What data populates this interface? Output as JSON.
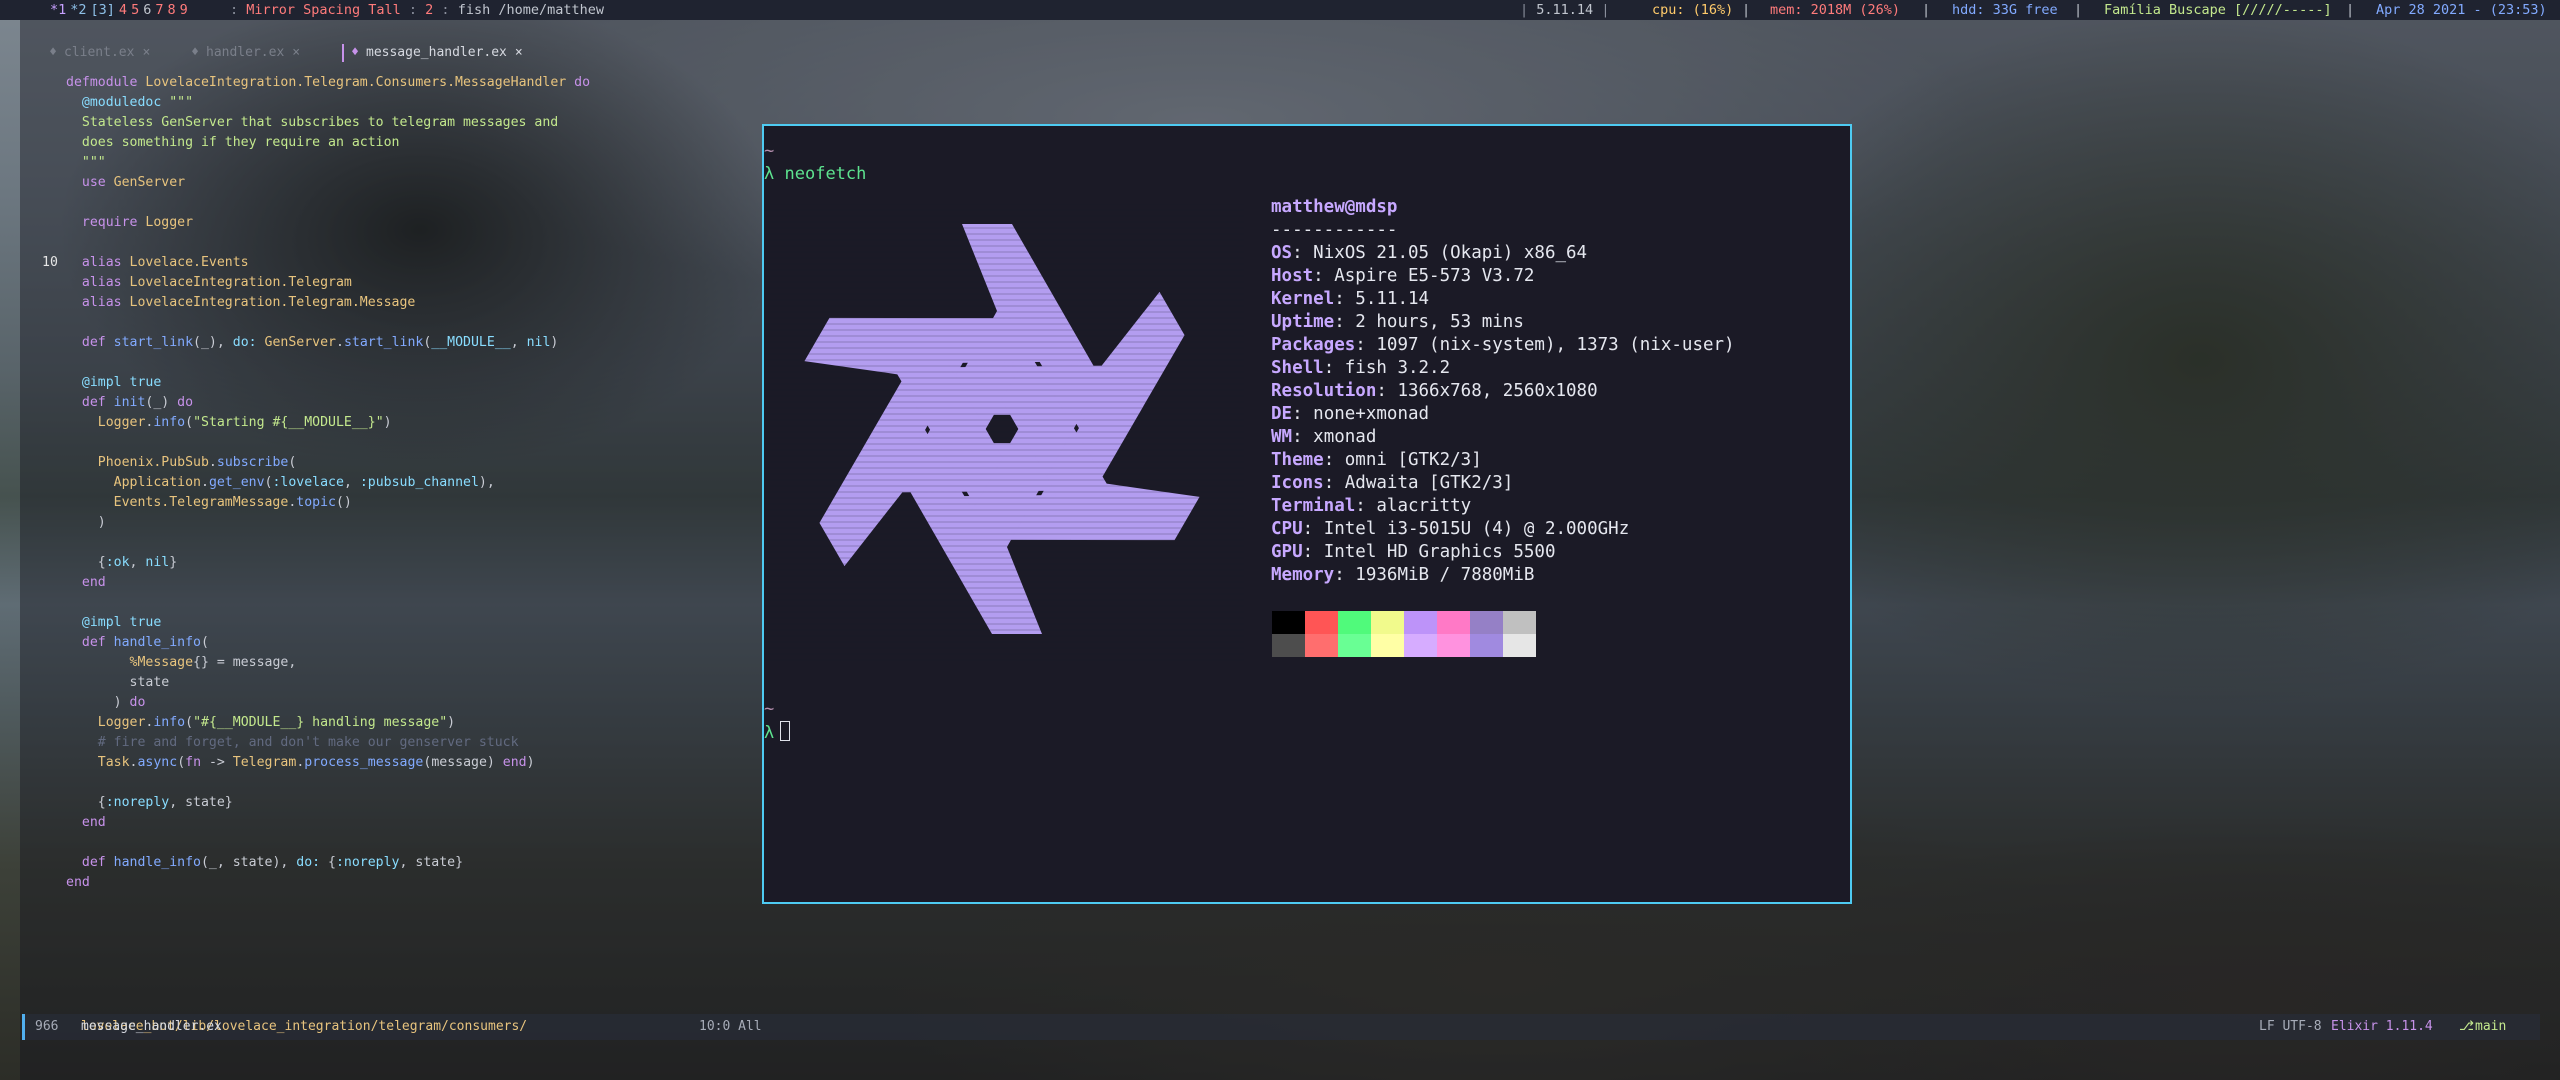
{
  "topbar": {
    "workspaces": [
      {
        "label": "*1",
        "state": "current"
      },
      {
        "label": "*2",
        "state": "visible"
      },
      {
        "label": "[3]",
        "state": "visible"
      },
      {
        "label": "4",
        "state": "hidden"
      },
      {
        "label": "5",
        "state": "hidden"
      },
      {
        "label": "6",
        "state": "plain"
      },
      {
        "label": "7",
        "state": "hidden"
      },
      {
        "label": "8",
        "state": "hidden"
      },
      {
        "label": "9",
        "state": "hidden"
      }
    ],
    "separator": ":",
    "layout": "Mirror Spacing Tall",
    "window_count": "2",
    "window_title": "fish /home/matthew",
    "kernel": "5.11.14",
    "cpu": "cpu: (16%)",
    "mem": "mem: 2018M (26%)",
    "hdd": "hdd: 33G free",
    "music": "Família Buscape [/////-----]",
    "clock": "Apr 28 2021 - (23:53)",
    "pipe": "|"
  },
  "editor": {
    "tabs": [
      {
        "label": "client.ex",
        "close": "×"
      },
      {
        "label": "handler.ex",
        "close": "×"
      },
      {
        "label": "message_handler.ex",
        "close": "×"
      }
    ],
    "code_lines": [
      {
        "ln": "",
        "parts": [
          [
            "kw",
            "defmodule "
          ],
          [
            "mod",
            "LovelaceIntegration.Telegram.Consumers.MessageHandler "
          ],
          [
            "kw",
            "do"
          ]
        ]
      },
      {
        "ln": "",
        "parts": [
          [
            "atom",
            "  @moduledoc "
          ],
          [
            "str",
            "\"\"\""
          ]
        ]
      },
      {
        "ln": "",
        "parts": [
          [
            "str",
            "  Stateless GenServer that subscribes to telegram messages and"
          ]
        ]
      },
      {
        "ln": "",
        "parts": [
          [
            "str",
            "  does something if they require an action"
          ]
        ]
      },
      {
        "ln": "",
        "parts": [
          [
            "str",
            "  \"\"\""
          ]
        ]
      },
      {
        "ln": "",
        "parts": [
          [
            "kw",
            "  use "
          ],
          [
            "mod",
            "GenServer"
          ]
        ]
      },
      {
        "ln": "",
        "parts": []
      },
      {
        "ln": "",
        "parts": [
          [
            "kw",
            "  require "
          ],
          [
            "mod",
            "Logger"
          ]
        ]
      },
      {
        "ln": "",
        "parts": []
      },
      {
        "ln": "10",
        "parts": [
          [
            "kw",
            "  alias "
          ],
          [
            "mod",
            "Lovelace.Events"
          ]
        ]
      },
      {
        "ln": "",
        "parts": [
          [
            "kw",
            "  alias "
          ],
          [
            "mod",
            "LovelaceIntegration.Telegram"
          ]
        ]
      },
      {
        "ln": "",
        "parts": [
          [
            "kw",
            "  alias "
          ],
          [
            "mod",
            "LovelaceIntegration.Telegram.Message"
          ]
        ]
      },
      {
        "ln": "",
        "parts": []
      },
      {
        "ln": "",
        "parts": [
          [
            "kw",
            "  def "
          ],
          [
            "fn",
            "start_link"
          ],
          [
            "df",
            "(_), "
          ],
          [
            "atom",
            "do: "
          ],
          [
            "mod",
            "GenServer"
          ],
          [
            "df",
            "."
          ],
          [
            "fn",
            "start_link"
          ],
          [
            "df",
            "("
          ],
          [
            "atom",
            "__MODULE__"
          ],
          [
            "df",
            ", "
          ],
          [
            "atom",
            "nil"
          ],
          [
            "df",
            ")"
          ]
        ]
      },
      {
        "ln": "",
        "parts": []
      },
      {
        "ln": "",
        "parts": [
          [
            "atom",
            "  @impl "
          ],
          [
            "atom",
            "true"
          ]
        ]
      },
      {
        "ln": "",
        "parts": [
          [
            "kw",
            "  def "
          ],
          [
            "fn",
            "init"
          ],
          [
            "df",
            "(_) "
          ],
          [
            "kw",
            "do"
          ]
        ]
      },
      {
        "ln": "",
        "parts": [
          [
            "mod",
            "    Logger"
          ],
          [
            "df",
            "."
          ],
          [
            "fn",
            "info"
          ],
          [
            "df",
            "("
          ],
          [
            "str",
            "\"Starting #{__MODULE__}\""
          ],
          [
            "df",
            ")"
          ]
        ]
      },
      {
        "ln": "",
        "parts": []
      },
      {
        "ln": "",
        "parts": [
          [
            "mod",
            "    Phoenix.PubSub"
          ],
          [
            "df",
            "."
          ],
          [
            "fn",
            "subscribe"
          ],
          [
            "df",
            "("
          ]
        ]
      },
      {
        "ln": "",
        "parts": [
          [
            "mod",
            "      Application"
          ],
          [
            "df",
            "."
          ],
          [
            "fn",
            "get_env"
          ],
          [
            "df",
            "("
          ],
          [
            "atom",
            ":lovelace"
          ],
          [
            "df",
            ", "
          ],
          [
            "atom",
            ":pubsub_channel"
          ],
          [
            "df",
            "),"
          ]
        ]
      },
      {
        "ln": "",
        "parts": [
          [
            "mod",
            "      Events.TelegramMessage"
          ],
          [
            "df",
            "."
          ],
          [
            "fn",
            "topic"
          ],
          [
            "df",
            "()"
          ]
        ]
      },
      {
        "ln": "",
        "parts": [
          [
            "df",
            "    )"
          ]
        ]
      },
      {
        "ln": "",
        "parts": []
      },
      {
        "ln": "",
        "parts": [
          [
            "df",
            "    {"
          ],
          [
            "atom",
            ":ok"
          ],
          [
            "df",
            ", "
          ],
          [
            "atom",
            "nil"
          ],
          [
            "df",
            "}"
          ]
        ]
      },
      {
        "ln": "",
        "parts": [
          [
            "kw",
            "  end"
          ]
        ]
      },
      {
        "ln": "",
        "parts": []
      },
      {
        "ln": "",
        "parts": [
          [
            "atom",
            "  @impl "
          ],
          [
            "atom",
            "true"
          ]
        ]
      },
      {
        "ln": "",
        "parts": [
          [
            "kw",
            "  def "
          ],
          [
            "fn",
            "handle_info"
          ],
          [
            "df",
            "("
          ]
        ]
      },
      {
        "ln": "",
        "parts": [
          [
            "mod",
            "        %Message"
          ],
          [
            "df",
            "{} = message,"
          ]
        ]
      },
      {
        "ln": "",
        "parts": [
          [
            "df",
            "        state"
          ]
        ]
      },
      {
        "ln": "",
        "parts": [
          [
            "df",
            "      ) "
          ],
          [
            "kw",
            "do"
          ]
        ]
      },
      {
        "ln": "",
        "parts": [
          [
            "mod",
            "    Logger"
          ],
          [
            "df",
            "."
          ],
          [
            "fn",
            "info"
          ],
          [
            "df",
            "("
          ],
          [
            "str",
            "\"#{__MODULE__} handling message\""
          ],
          [
            "df",
            ")"
          ]
        ]
      },
      {
        "ln": "",
        "parts": [
          [
            "cm",
            "    # fire and forget, and don't make our genserver stuck"
          ]
        ]
      },
      {
        "ln": "",
        "parts": [
          [
            "mod",
            "    Task"
          ],
          [
            "df",
            "."
          ],
          [
            "fn",
            "async"
          ],
          [
            "df",
            "("
          ],
          [
            "kw",
            "fn "
          ],
          [
            "df",
            "-> "
          ],
          [
            "mod",
            "Telegram"
          ],
          [
            "df",
            "."
          ],
          [
            "fn",
            "process_message"
          ],
          [
            "df",
            "(message) "
          ],
          [
            "kw",
            "end"
          ],
          [
            "df",
            ")"
          ]
        ]
      },
      {
        "ln": "",
        "parts": []
      },
      {
        "ln": "",
        "parts": [
          [
            "df",
            "    {"
          ],
          [
            "atom",
            ":noreply"
          ],
          [
            "df",
            ", state}"
          ]
        ]
      },
      {
        "ln": "",
        "parts": [
          [
            "kw",
            "  end"
          ]
        ]
      },
      {
        "ln": "",
        "parts": []
      },
      {
        "ln": "",
        "parts": [
          [
            "kw",
            "  def "
          ],
          [
            "fn",
            "handle_info"
          ],
          [
            "df",
            "(_, state), "
          ],
          [
            "atom",
            "do: "
          ],
          [
            "df",
            "{"
          ],
          [
            "atom",
            ":noreply"
          ],
          [
            "df",
            ", state}"
          ]
        ]
      },
      {
        "ln": "",
        "parts": [
          [
            "kw",
            "end"
          ]
        ]
      }
    ],
    "modeline": {
      "buffer_size": "966",
      "path_dir": "lovelace_bot/lib/lovelace_integration/telegram/consumers/",
      "path_file": "message_handler.ex",
      "position": "10:0 All",
      "encoding": "LF UTF-8",
      "mode": "Elixir 1.11.4",
      "branch_icon": "⎇",
      "branch": "main"
    }
  },
  "terminal": {
    "tilde": "~",
    "prompt": "λ",
    "command": "neofetch",
    "user": "matthew@mdsp",
    "rule": "------------",
    "info": [
      {
        "key": "OS",
        "value": "NixOS 21.05 (Okapi) x86_64"
      },
      {
        "key": "Host",
        "value": "Aspire E5-573 V3.72"
      },
      {
        "key": "Kernel",
        "value": "5.11.14"
      },
      {
        "key": "Uptime",
        "value": "2 hours, 53 mins"
      },
      {
        "key": "Packages",
        "value": "1097 (nix-system), 1373 (nix-user)"
      },
      {
        "key": "Shell",
        "value": "fish 3.2.2"
      },
      {
        "key": "Resolution",
        "value": "1366x768, 2560x1080"
      },
      {
        "key": "DE",
        "value": "none+xmonad"
      },
      {
        "key": "WM",
        "value": "xmonad"
      },
      {
        "key": "Theme",
        "value": "omni [GTK2/3]"
      },
      {
        "key": "Icons",
        "value": "Adwaita [GTK2/3]"
      },
      {
        "key": "Terminal",
        "value": "alacritty"
      },
      {
        "key": "CPU",
        "value": "Intel i3-5015U (4) @ 2.000GHz"
      },
      {
        "key": "GPU",
        "value": "Intel HD Graphics 5500"
      },
      {
        "key": "Memory",
        "value": "1936MiB / 7880MiB"
      }
    ],
    "palette_top": [
      "#000000",
      "#ff5555",
      "#50fa7b",
      "#f1fa8c",
      "#bd93f9",
      "#ff79c6",
      "#9580c6",
      "#c0c0c0"
    ],
    "palette_bottom": [
      "#4d4d4d",
      "#ff6e6e",
      "#69ff94",
      "#ffffa5",
      "#d6acff",
      "#ff92df",
      "#a08ae0",
      "#e6e6e6"
    ],
    "logo_color": "#b39df0",
    "border_color": "#4ecbf2"
  }
}
